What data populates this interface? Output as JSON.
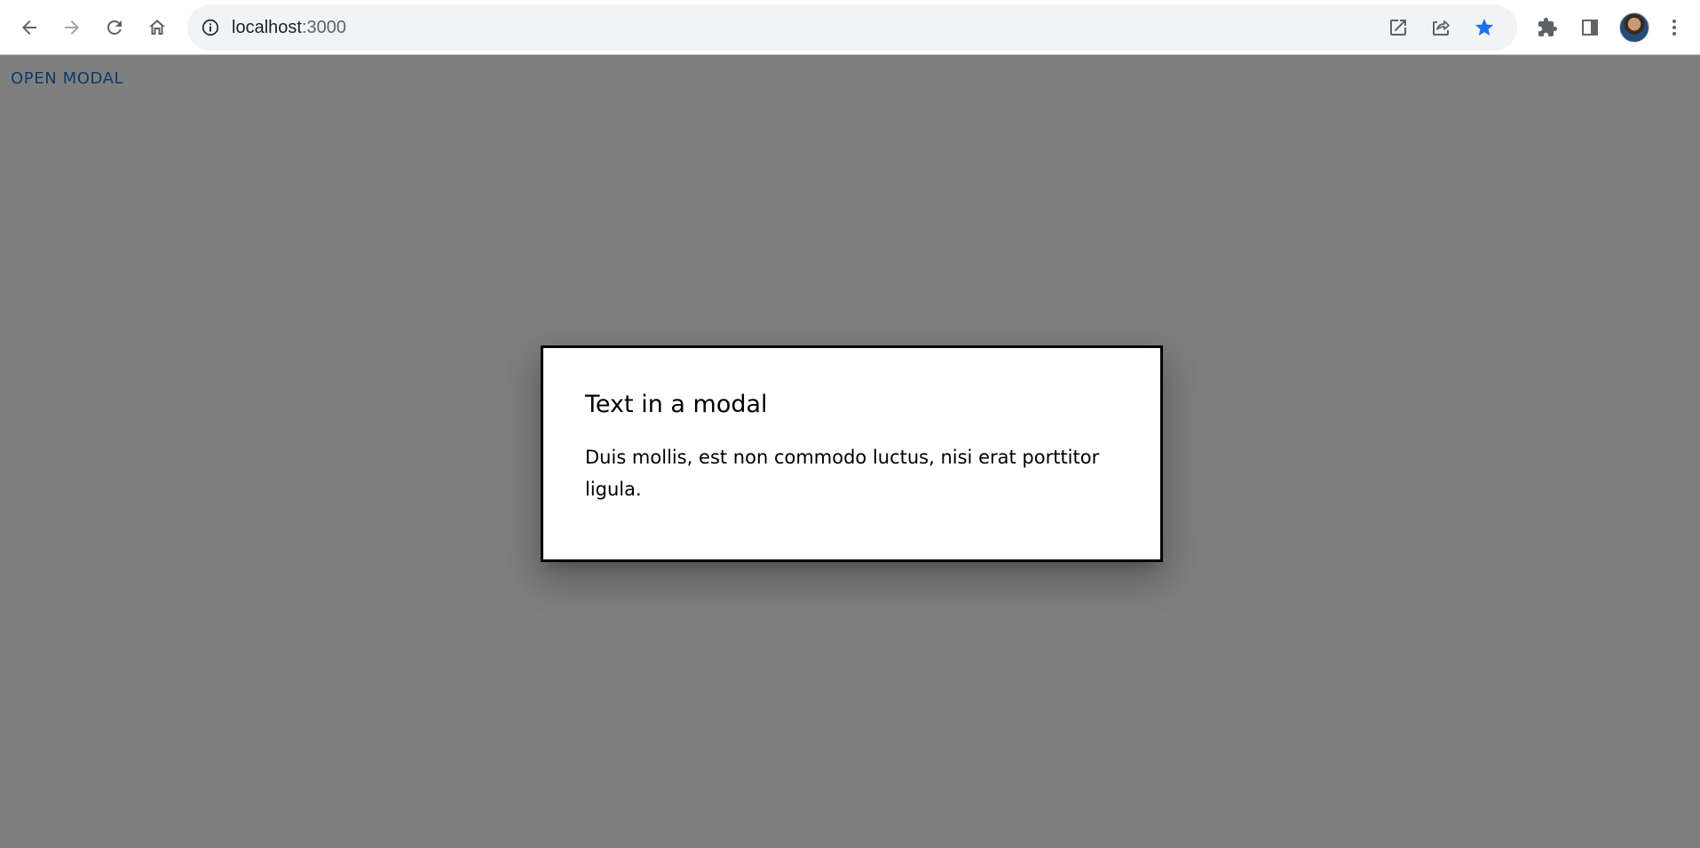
{
  "browser": {
    "url_host": "localhost",
    "url_port": ":3000",
    "icons": {
      "back": "arrow-left-icon",
      "forward": "arrow-right-icon",
      "reload": "reload-icon",
      "home": "home-icon",
      "site_info": "info-icon",
      "open_in_app": "open-external-icon",
      "share": "share-icon",
      "bookmark": "star-icon",
      "extensions": "puzzle-icon",
      "side_panel": "side-panel-icon",
      "profile": "avatar",
      "menu": "kebab-menu-icon"
    },
    "colors": {
      "bookmark_star": "#1a73e8",
      "toolbar_icon": "#5f6368",
      "omnibox_bg": "#f1f3f4"
    }
  },
  "page": {
    "open_modal_label": "OPEN MODAL",
    "backdrop_color": "#808080",
    "link_color": "#1976d2"
  },
  "modal": {
    "title": "Text in a modal",
    "description": "Duis mollis, est non commodo luctus, nisi erat porttitor ligula."
  }
}
